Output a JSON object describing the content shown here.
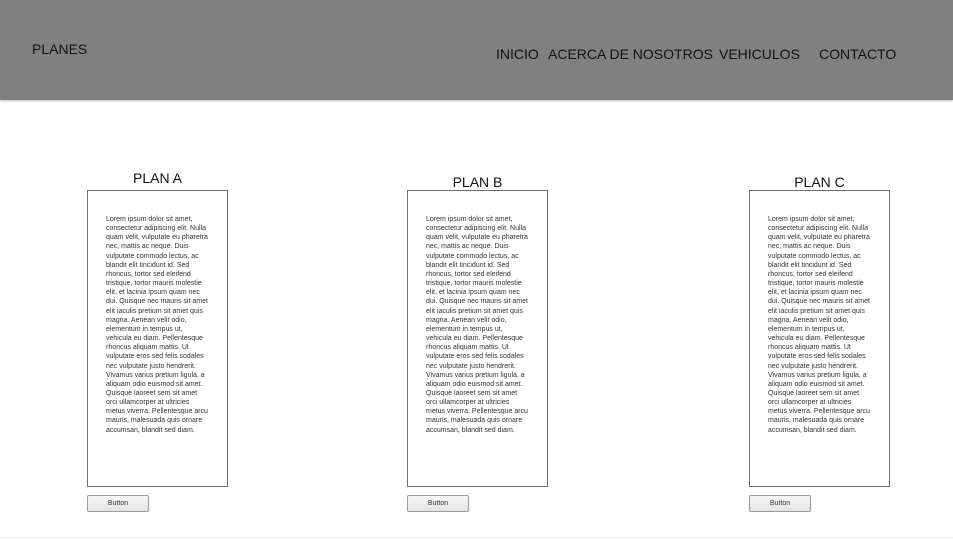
{
  "header": {
    "brand": "PLANES",
    "nav": {
      "inicio": "INICIO",
      "acerca": "ACERCA DE NOSOTROS",
      "vehiculos": "VEHICULOS",
      "contacto": "CONTACTO"
    }
  },
  "plans": [
    {
      "title": "PLAN A",
      "body": "Lorem ipsum dolor sit amet, consectetur adipiscing elit. Nulla quam velit, vulputate eu pharetra nec, mattis ac neque. Duis vulputate commodo lectus, ac blandit elit tincidunt id. Sed rhoncus, tortor sed eleifend tristique, tortor mauris molestie elit, et lacinia ipsum quam nec dui. Quisque nec mauris sit amet elit iaculis pretium sit amet quis magna. Aenean velit odio, elementum in tempus ut, vehicula eu diam. Pellentesque rhoncus aliquam mattis. Ut vulputate eros sed felis sodales nec vulputate justo hendrerit. Vivamus varius pretium ligula, a aliquam odio euismod sit amet. Quisque laoreet sem sit amet orci ullamcorper at ultricies metus viverra. Pellentesque arcu mauris, malesuada quis ornare accumsan, blandit sed diam.",
      "button": "Button"
    },
    {
      "title": "PLAN B",
      "body": "Lorem ipsum dolor sit amet, consectetur adipiscing elit. Nulla quam velit, vulputate eu pharetra nec, mattis ac neque. Duis vulputate commodo lectus, ac blandit elit tincidunt id. Sed rhoncus, tortor sed eleifend tristique, tortor mauris molestie elit, et lacinia ipsum quam nec dui. Quisque nec mauris sit amet elit iaculis pretium sit amet quis magna. Aenean velit odio, elementum in tempus ut, vehicula eu diam. Pellentesque rhoncus aliquam mattis. Ut vulputate eros sed felis sodales nec vulputate justo hendrerit. Vivamus varius pretium ligula, a aliquam odio euismod sit amet. Quisque laoreet sem sit amet orci ullamcorper at ultricies metus viverra. Pellentesque arcu mauris, malesuada quis ornare accumsan, blandit sed diam.",
      "button": "Button"
    },
    {
      "title": "PLAN C",
      "body": "Lorem ipsum dolor sit amet, consectetur adipiscing elit. Nulla quam velit, vulputate eu pharetra nec, mattis ac neque. Duis vulputate commodo lectus, ac blandit elit tincidunt id. Sed rhoncus, tortor sed eleifend tristique, tortor mauris molestie elit, et lacinia ipsum quam nec dui. Quisque nec mauris sit amet elit iaculis pretium sit amet quis magna. Aenean velit odio, elementum in tempus ut, vehicula eu diam. Pellentesque rhoncus aliquam mattis. Ut vulputate eros sed felis sodales nec vulputate justo hendrerit. Vivamus varius pretium ligula, a aliquam odio euismod sit amet. Quisque laoreet sem sit amet orci ullamcorper at ultricies metus viverra. Pellentesque arcu mauris, malesuada quis ornare accumsan, blandit sed diam.",
      "button": "Button"
    }
  ],
  "colors": {
    "header_bg": "#808080",
    "page_bg": "#ffffff",
    "card_border": "#6e6e6e"
  }
}
